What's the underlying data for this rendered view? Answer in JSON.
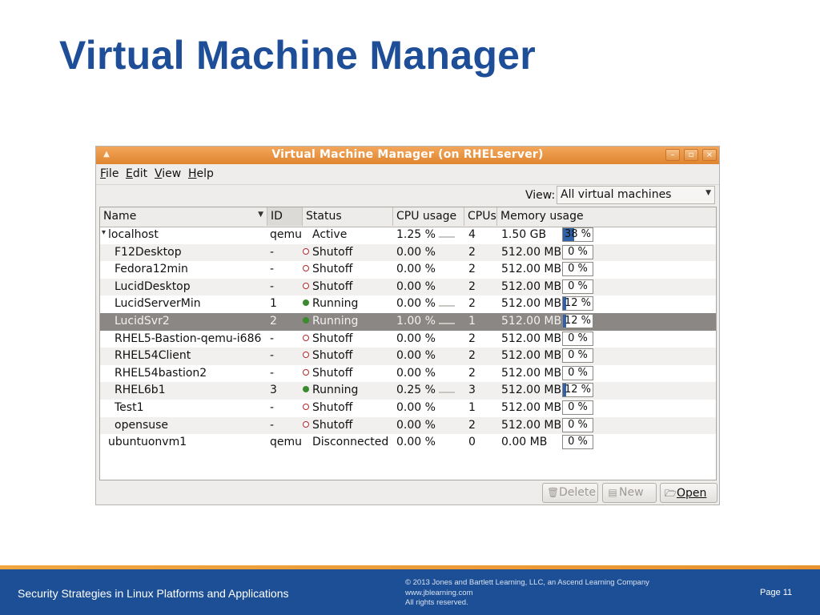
{
  "slide": {
    "title": "Virtual Machine Manager"
  },
  "window": {
    "title": "Virtual Machine Manager (on RHELserver)",
    "controls": {
      "minimize": "–",
      "maximize": "▫",
      "close": "×"
    }
  },
  "menubar": {
    "items": [
      {
        "label_underlined": "F",
        "label_rest": "ile"
      },
      {
        "label_underlined": "E",
        "label_rest": "dit"
      },
      {
        "label_underlined": "V",
        "label_rest": "iew"
      },
      {
        "label_underlined": "H",
        "label_rest": "elp"
      }
    ]
  },
  "view_filter": {
    "label": "View:",
    "value": "All virtual machines"
  },
  "table": {
    "columns": [
      "Name",
      "ID",
      "Status",
      "CPU usage",
      "CPUs",
      "Memory usage"
    ],
    "rows": [
      {
        "name": "localhost",
        "id": "qemu",
        "status": "Active",
        "status_icon": "none",
        "cpu": "1.25 %",
        "cpus": "4",
        "mem": "1.50 GB",
        "mem_pct_label": "38 %",
        "mem_pct": 38,
        "level": 0
      },
      {
        "name": "F12Desktop",
        "id": "-",
        "status": "Shutoff",
        "status_icon": "shutoff-icon",
        "cpu": "0.00 %",
        "cpus": "2",
        "mem": "512.00 MB",
        "mem_pct_label": "0 %",
        "mem_pct": 0,
        "level": 1
      },
      {
        "name": "Fedora12min",
        "id": "-",
        "status": "Shutoff",
        "status_icon": "shutoff-icon",
        "cpu": "0.00 %",
        "cpus": "2",
        "mem": "512.00 MB",
        "mem_pct_label": "0 %",
        "mem_pct": 0,
        "level": 1
      },
      {
        "name": "LucidDesktop",
        "id": "-",
        "status": "Shutoff",
        "status_icon": "shutoff-icon",
        "cpu": "0.00 %",
        "cpus": "2",
        "mem": "512.00 MB",
        "mem_pct_label": "0 %",
        "mem_pct": 0,
        "level": 1
      },
      {
        "name": "LucidServerMin",
        "id": "1",
        "status": "Running",
        "status_icon": "running-icon",
        "cpu": "0.00 %",
        "cpus": "2",
        "mem": "512.00 MB",
        "mem_pct_label": "12 %",
        "mem_pct": 12,
        "level": 1
      },
      {
        "name": "LucidSvr2",
        "id": "2",
        "status": "Running",
        "status_icon": "running-icon",
        "cpu": "1.00 %",
        "cpus": "1",
        "mem": "512.00 MB",
        "mem_pct_label": "12 %",
        "mem_pct": 12,
        "level": 1,
        "selected": true
      },
      {
        "name": "RHEL5-Bastion-qemu-i686",
        "id": "-",
        "status": "Shutoff",
        "status_icon": "shutoff-icon",
        "cpu": "0.00 %",
        "cpus": "2",
        "mem": "512.00 MB",
        "mem_pct_label": "0 %",
        "mem_pct": 0,
        "level": 1
      },
      {
        "name": "RHEL54Client",
        "id": "-",
        "status": "Shutoff",
        "status_icon": "shutoff-icon",
        "cpu": "0.00 %",
        "cpus": "2",
        "mem": "512.00 MB",
        "mem_pct_label": "0 %",
        "mem_pct": 0,
        "level": 1
      },
      {
        "name": "RHEL54bastion2",
        "id": "-",
        "status": "Shutoff",
        "status_icon": "shutoff-icon",
        "cpu": "0.00 %",
        "cpus": "2",
        "mem": "512.00 MB",
        "mem_pct_label": "0 %",
        "mem_pct": 0,
        "level": 1
      },
      {
        "name": "RHEL6b1",
        "id": "3",
        "status": "Running",
        "status_icon": "running-icon",
        "cpu": "0.25 %",
        "cpus": "3",
        "mem": "512.00 MB",
        "mem_pct_label": "12 %",
        "mem_pct": 12,
        "level": 1
      },
      {
        "name": "Test1",
        "id": "-",
        "status": "Shutoff",
        "status_icon": "shutoff-icon",
        "cpu": "0.00 %",
        "cpus": "1",
        "mem": "512.00 MB",
        "mem_pct_label": "0 %",
        "mem_pct": 0,
        "level": 1
      },
      {
        "name": "opensuse",
        "id": "-",
        "status": "Shutoff",
        "status_icon": "shutoff-icon",
        "cpu": "0.00 %",
        "cpus": "2",
        "mem": "512.00 MB",
        "mem_pct_label": "0 %",
        "mem_pct": 0,
        "level": 1
      },
      {
        "name": "ubuntuonvm1",
        "id": "qemu",
        "status": "Disconnected",
        "status_icon": "none",
        "cpu": "0.00 %",
        "cpus": "0",
        "mem": "0.00 MB",
        "mem_pct_label": "0 %",
        "mem_pct": 0,
        "level": 0
      }
    ]
  },
  "buttons": {
    "delete": {
      "label": "Delete",
      "icon": "trash-icon"
    },
    "new": {
      "label": "New",
      "icon": "new-document-icon"
    },
    "open": {
      "label": "Open",
      "icon": "folder-open-icon"
    }
  },
  "footer": {
    "course": "Security Strategies in Linux Platforms and Applications",
    "copyright": "© 2013 Jones and Bartlett Learning, LLC, an Ascend Learning Company",
    "website": "www.jblearning.com",
    "rights": "All rights reserved.",
    "page": "Page 11"
  },
  "colors": {
    "slide_title": "#1f4e99",
    "titlebar": "#e0852f",
    "footer_bg": "#1c4f95",
    "footer_accent": "#f0a540",
    "selected_row": "#8a8784",
    "mem_bar_fill": "#2f62a8"
  }
}
